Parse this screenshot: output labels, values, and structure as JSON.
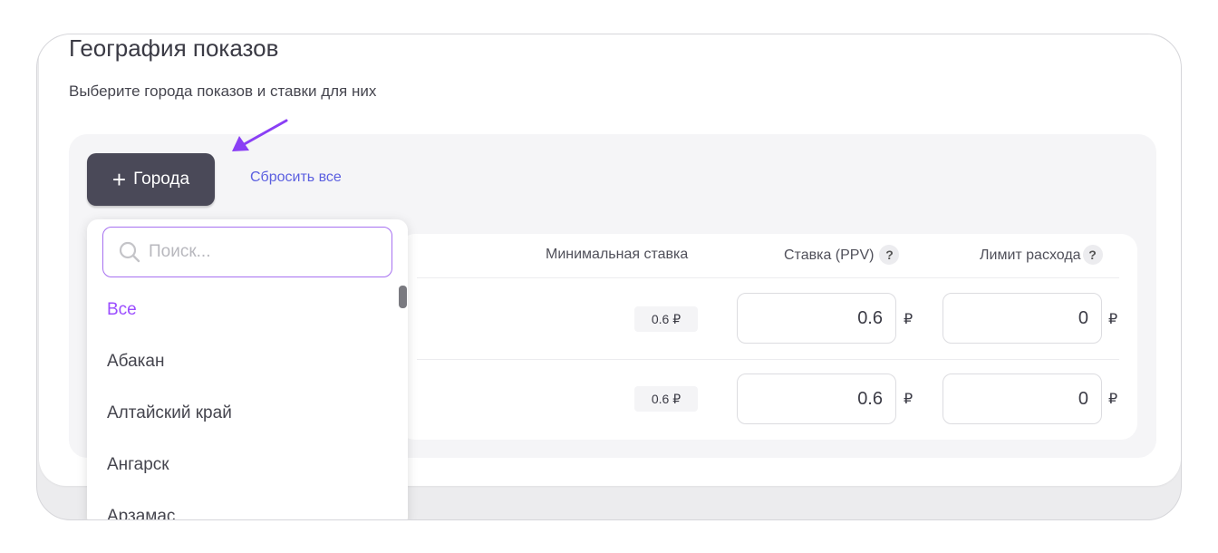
{
  "header": {
    "title": "География показов",
    "subtitle": "Выберите города показов и ставки для них"
  },
  "toolbar": {
    "add_cities_label": "Города",
    "reset_label": "Сбросить все"
  },
  "table": {
    "columns": {
      "min_bid": "Минимальная ставка",
      "bid": "Ставка (PPV)",
      "limit": "Лимит расхода",
      "help": "?"
    },
    "rows": [
      {
        "min_bid": "0.6 ₽",
        "bid": "0.6",
        "limit": "0",
        "currency": "₽"
      },
      {
        "min_bid": "0.6 ₽",
        "bid": "0.6",
        "limit": "0",
        "currency": "₽"
      }
    ]
  },
  "dropdown": {
    "search_placeholder": "Поиск...",
    "items": [
      "Все",
      "Абакан",
      "Алтайский край",
      "Ангарск",
      "Арзамас"
    ],
    "selected": "Все"
  },
  "colors": {
    "accent": "#9b4dff",
    "button": "#4a4958",
    "link": "#5b5fe0"
  }
}
